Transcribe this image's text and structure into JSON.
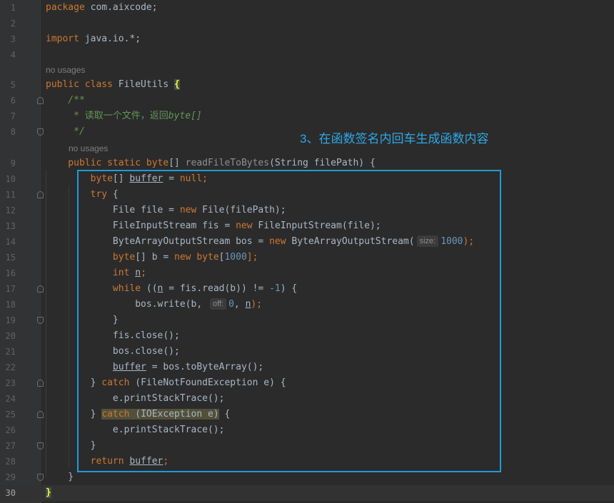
{
  "hints": {
    "usage_top": "no usages",
    "usage_method": "no usages"
  },
  "inlays": {
    "size": "size:",
    "off": "off:"
  },
  "annotation": "3、在函数签名内回车生成函数内容",
  "line_numbers": [
    "1",
    "2",
    "3",
    "4",
    "5",
    "6",
    "7",
    "8",
    "9",
    "10",
    "11",
    "12",
    "13",
    "14",
    "15",
    "16",
    "17",
    "18",
    "19",
    "20",
    "21",
    "22",
    "23",
    "24",
    "25",
    "26",
    "27",
    "28",
    "29",
    "30"
  ],
  "code": {
    "l1_kw": "package",
    "l1_rest": " com.aixcode;",
    "l3_kw": "import",
    "l3_rest": " java.io.*;",
    "l5_kw": "public class ",
    "l5_name": "FileUtils ",
    "l5_brace": "{",
    "l6": "    /**",
    "l7_a": "     * 读取一个文件，返回",
    "l7_b": "byte[]",
    "l8": "     */",
    "l9_kw": "    public static byte",
    "l9_a": "[] ",
    "l9_fn": "readFileToBytes",
    "l9_b": "(String filePath) {",
    "l10_kw": "        byte",
    "l10_a": "[] ",
    "l10_var": "buffer",
    "l10_b": " = ",
    "l10_kw2": "null",
    "l10_c": ";",
    "l11_kw": "        try",
    "l11_a": " {",
    "l12_a": "            File file = ",
    "l12_kw": "new",
    "l12_b": " File(filePath);",
    "l13_a": "            FileInputStream fis = ",
    "l13_kw": "new",
    "l13_b": " FileInputStream(file);",
    "l14_a": "            ByteArrayOutputStream bos = ",
    "l14_kw": "new",
    "l14_b": " ByteArrayOutputStream(",
    "l14_num": "1000",
    "l14_c": ");",
    "l15_kw": "            byte",
    "l15_a": "[] b = ",
    "l15_kw2": "new",
    "l15_kw3": " byte",
    "l15_b": "[",
    "l15_num": "1000",
    "l15_c": "];",
    "l16_kw": "            int",
    "l16_sp": " ",
    "l16_var": "n",
    "l16_a": ";",
    "l17_kw": "            while",
    "l17_a": " ((",
    "l17_var": "n",
    "l17_b": " = fis.read(b)) != ",
    "l17_num": "-1",
    "l17_c": ") {",
    "l18_a": "                bos.write(b, ",
    "l18_num": "0",
    "l18_b": ", ",
    "l18_var": "n",
    "l18_c": ");",
    "l19": "            }",
    "l20": "            fis.close();",
    "l21": "            bos.close();",
    "l22_var": "buffer",
    "l22_a": " = bos.toByteArray();",
    "l22_indent": "            ",
    "l23_a": "        } ",
    "l23_kw": "catch",
    "l23_b": " (FileNotFoundException e) {",
    "l24": "            e.printStackTrace();",
    "l25_a": "        } ",
    "l25_kw": "catch",
    "l25_b": " (IOException e)",
    "l25_c": " {",
    "l26": "            e.printStackTrace();",
    "l27": "        }",
    "l28_kw": "        return",
    "l28_sp": " ",
    "l28_var": "buffer",
    "l28_a": ";",
    "l29": "    }",
    "l30": "}"
  }
}
